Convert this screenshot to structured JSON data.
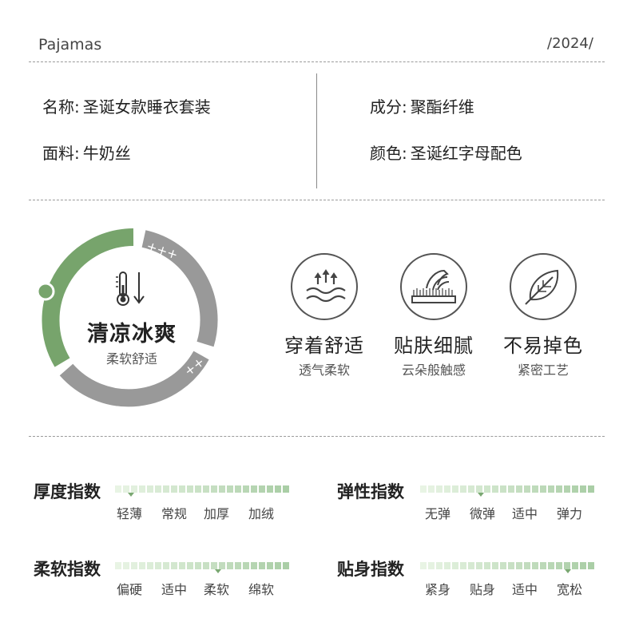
{
  "header": {
    "brand": "Pajamas",
    "year": "/2024/"
  },
  "info": {
    "name": {
      "label": "名称:",
      "value": "圣诞女款睡衣套装"
    },
    "material": {
      "label": "面料:",
      "value": "牛奶丝"
    },
    "composition": {
      "label": "成分:",
      "value": "聚酯纤维"
    },
    "color": {
      "label": "颜色:",
      "value": "圣诞红字母配色"
    }
  },
  "ring": {
    "title": "清凉冰爽",
    "subtitle": "柔软舒适",
    "plus_top": "+++",
    "plus_bottom": "++",
    "colors": {
      "green": "#77a46c",
      "gray": "#999999"
    }
  },
  "features": [
    {
      "icon": "breathable-waves-icon",
      "title": "穿着舒适",
      "subtitle": "透气柔软"
    },
    {
      "icon": "hand-touch-fabric-icon",
      "title": "贴肤细腻",
      "subtitle": "云朵般触感"
    },
    {
      "icon": "leaf-icon",
      "title": "不易掉色",
      "subtitle": "紧密工艺"
    }
  ],
  "metrics": [
    {
      "title": "厚度指数",
      "options": [
        "轻薄",
        "常规",
        "加厚",
        "加绒"
      ],
      "selected_index": 0
    },
    {
      "title": "弹性指数",
      "options": [
        "无弹",
        "微弹",
        "适中",
        "弹力"
      ],
      "selected_index": 1
    },
    {
      "title": "柔软指数",
      "options": [
        "偏硬",
        "适中",
        "柔软",
        "绵软"
      ],
      "selected_index": 2
    },
    {
      "title": "贴身指数",
      "options": [
        "紧身",
        "贴身",
        "适中",
        "宽松"
      ],
      "selected_index": 3
    }
  ]
}
